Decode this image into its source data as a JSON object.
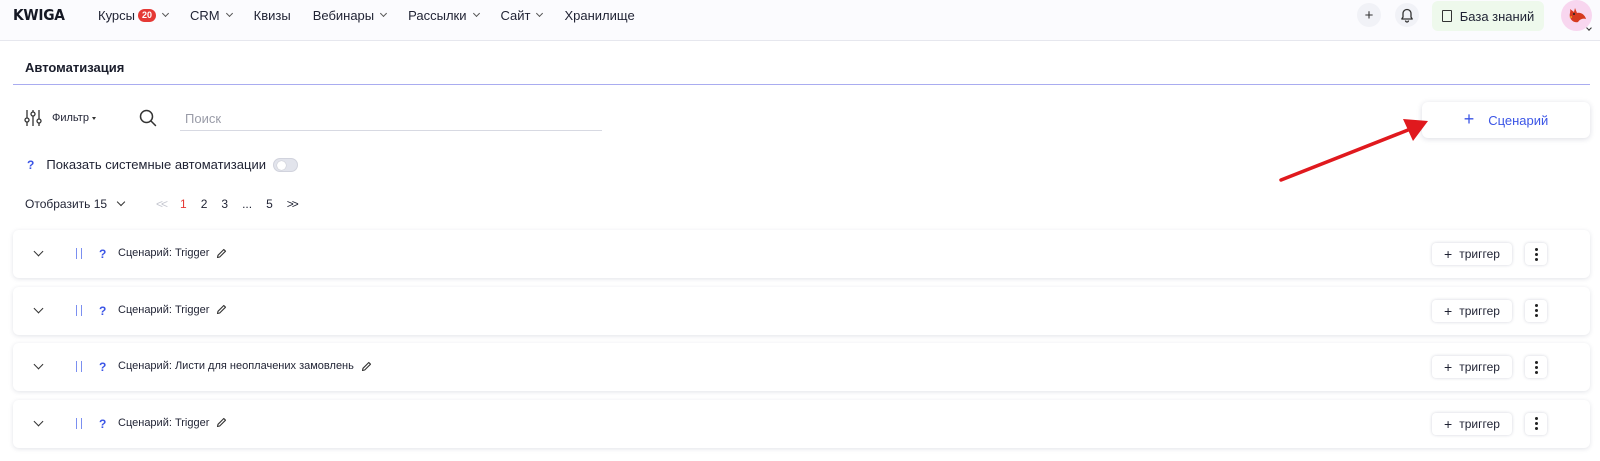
{
  "app": {
    "logo": "KWIGA"
  },
  "nav": [
    {
      "label": "Курсы",
      "badge": "20",
      "has_dropdown": true
    },
    {
      "label": "CRM",
      "has_dropdown": true
    },
    {
      "label": "Квизы",
      "has_dropdown": false
    },
    {
      "label": "Вебинары",
      "has_dropdown": true
    },
    {
      "label": "Рассылки",
      "has_dropdown": true
    },
    {
      "label": "Сайт",
      "has_dropdown": true
    },
    {
      "label": "Хранилище",
      "has_dropdown": false
    }
  ],
  "top_right": {
    "add_icon": "plus-icon",
    "notifications_icon": "bell-icon",
    "knowledge_base_label": "База знаний"
  },
  "page": {
    "title": "Автоматизация"
  },
  "toolbar": {
    "filter_label": "Фильтр",
    "search_placeholder": "Поиск",
    "search_value": "",
    "add_scenario_label": "Сценарий"
  },
  "system_automations": {
    "help": "?",
    "label": "Показать системные автоматизации",
    "enabled": false
  },
  "pagination": {
    "per_page_label": "Отобразить 15",
    "first": "<<",
    "pages": [
      "1",
      "2",
      "3",
      "...",
      "5"
    ],
    "current_page": "1",
    "next": ">>"
  },
  "rows": [
    {
      "help": "?",
      "name": "Сценарий: Trigger",
      "trigger_label": "триггер"
    },
    {
      "help": "?",
      "name": "Сценарий: Trigger",
      "trigger_label": "триггер"
    },
    {
      "help": "?",
      "name": "Сценарий: Листи для неоплачених замовлень",
      "trigger_label": "триггер"
    },
    {
      "help": "?",
      "name": "Сценарий: Trigger",
      "trigger_label": "триггер"
    }
  ],
  "colors": {
    "accent": "#3b55e6",
    "badge": "#e53935",
    "annotation_arrow": "#e0191e",
    "knowledge_base_bg": "#eef9ec"
  }
}
